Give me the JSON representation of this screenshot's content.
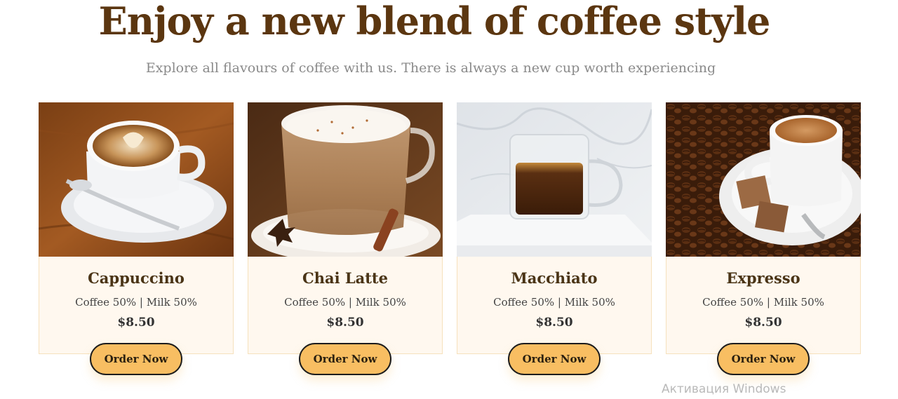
{
  "hero": {
    "title": "Enjoy a new blend of coffee style",
    "subtitle": "Explore all flavours of coffee with us. There is always a new cup worth experiencing"
  },
  "products": [
    {
      "name": "Cappuccino",
      "mix": "Coffee 50% | Milk 50%",
      "price": "$8.50",
      "button": "Order Now"
    },
    {
      "name": "Chai Latte",
      "mix": "Coffee 50% | Milk 50%",
      "price": "$8.50",
      "button": "Order Now"
    },
    {
      "name": "Macchiato",
      "mix": "Coffee 50% | Milk 50%",
      "price": "$8.50",
      "button": "Order Now"
    },
    {
      "name": "Expresso",
      "mix": "Coffee 50% | Milk 50%",
      "price": "$8.50",
      "button": "Order Now"
    }
  ],
  "watermark": "Активация Windows",
  "colors": {
    "title": "#5b3610",
    "button": "#f8be62",
    "card_background": "#fff8ef",
    "card_border": "#f6e1bd"
  }
}
